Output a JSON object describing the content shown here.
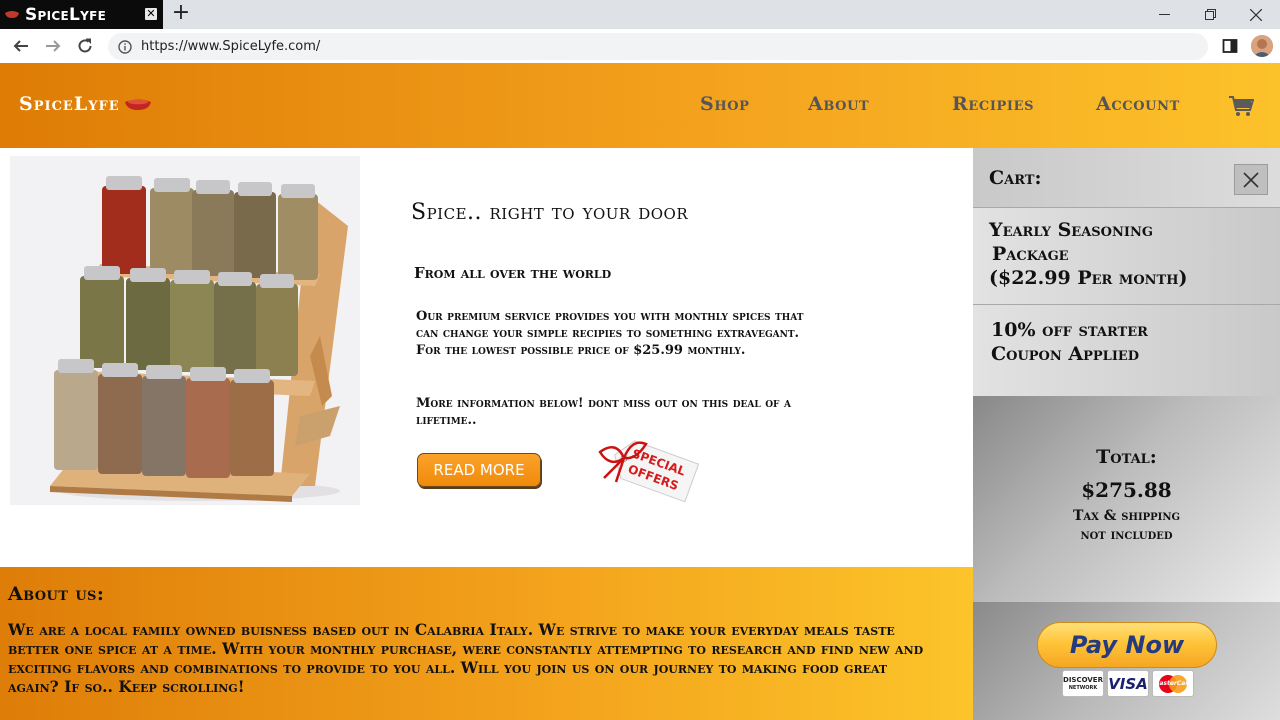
{
  "browser": {
    "tab_title": "SpiceLyfe",
    "tab_close": "✕",
    "new_tab": "+",
    "url": "https://www.SpiceLyfe.com/",
    "icons": [
      "back-arrow-icon",
      "forward-arrow-icon",
      "reload-icon",
      "site-info-icon",
      "side-panel-icon",
      "profile-avatar",
      "minimize-icon",
      "restore-icon",
      "close-window-icon"
    ]
  },
  "header": {
    "brand": "SpiceLyfe",
    "nav": [
      "Shop",
      "About",
      "Recipies",
      "Account"
    ],
    "cart_icon": "cart-icon"
  },
  "hero": {
    "title": "Spice.. right to your door",
    "subtitle": "From all over the world",
    "paragraph1": "Our premium service provides you with monthly spices that can change your simple recipies to something extravegant. For the lowest possible price of $25.99 monthly.",
    "paragraph2": "More information below! dont miss out on this deal of a lifetime..",
    "read_more": "READ MORE",
    "tag_line1": "SPECIAL",
    "tag_line2": "OFFERS"
  },
  "about": {
    "title": "About us:",
    "text": "We are a local family owned buisness based out in Calabria Italy. We strive to make your everyday meals taste better one spice at a time. With your monthly purchase, were constantly attempting to research and find new and exciting flavors and combinations to provide to you all. Will you join us on our journey to making food great again? If so.. Keep scrolling!"
  },
  "cart": {
    "title": "Cart:",
    "items": [
      {
        "line1": "Yearly Seasoning",
        "line2": "Package",
        "line3": "($22.99 Per month)"
      },
      {
        "line1": "10% off starter",
        "line2": "Coupon Applied"
      }
    ],
    "total_label": "Total:",
    "total_amount": "$275.88",
    "note_line1": "Tax & shipping",
    "note_line2": "not included",
    "pay_button": "Pay Now",
    "card_logos": [
      "DISCOVER",
      "NETWORK",
      "VISA",
      "MasterCard"
    ]
  },
  "colors": {
    "header_orange": "#de7c05",
    "header_yellow": "#fcc22a",
    "button_orange": "#f08a0a",
    "paypal_gold": "#ffc439",
    "paypal_blue": "#253b80",
    "cart_grey": "#9a9a9a"
  }
}
